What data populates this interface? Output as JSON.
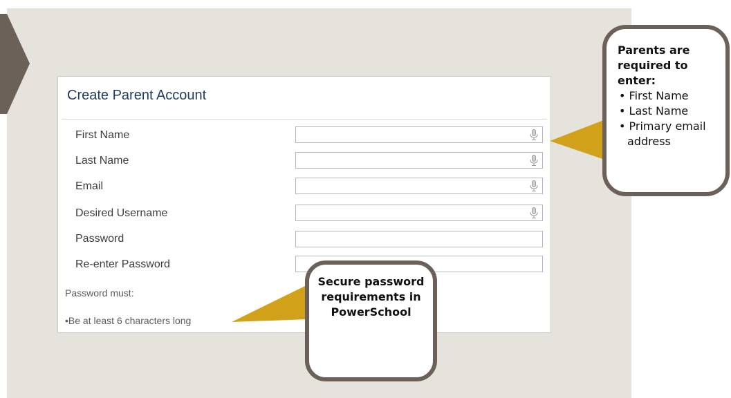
{
  "form": {
    "title": "Create Parent Account",
    "fields": [
      {
        "label": "First Name",
        "value": "",
        "has_mic": true
      },
      {
        "label": "Last Name",
        "value": "",
        "has_mic": true
      },
      {
        "label": "Email",
        "value": "",
        "has_mic": true
      },
      {
        "label": "Desired Username",
        "value": "",
        "has_mic": true
      },
      {
        "label": "Password",
        "value": "",
        "has_mic": false
      },
      {
        "label": "Re-enter Password",
        "value": "",
        "has_mic": false
      }
    ],
    "password_note": "Password must:",
    "password_rule": "•Be at least 6 characters long"
  },
  "callouts": {
    "required": {
      "heading": "Parents are required to enter:",
      "items": [
        "First Name",
        "Last Name",
        "Primary email address"
      ]
    },
    "password": {
      "text": "Secure password requirements in PowerSchool"
    }
  },
  "colors": {
    "panel_bg": "#e6e2dc",
    "callout_border": "#6b6159",
    "pointer_gold": "#d0a119",
    "arrow_brown": "#6b6159",
    "title_text": "#1f3a5c"
  },
  "icons": {
    "field_icon": "microphone-icon",
    "side_marker": "chevron-right-icon"
  }
}
